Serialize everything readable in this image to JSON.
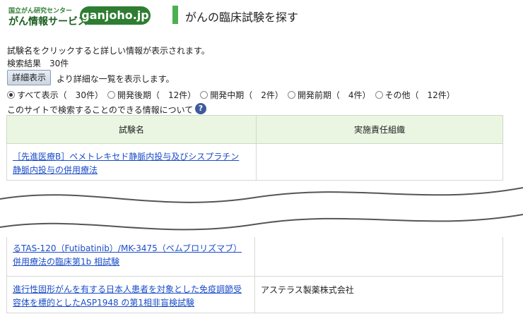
{
  "header": {
    "logo_small": "国立がん研究センター",
    "logo_big": "がん情報サービス",
    "logo_pill": "ganjoho.jp",
    "page_title": "がんの臨床試験を探す"
  },
  "intro": {
    "click_hint": "試験名をクリックすると詳しい情報が表示されます。",
    "results_count": "検索結果　30件",
    "detail_button": "詳細表示",
    "detail_hint": "より詳細な一覧を表示します。"
  },
  "filters": [
    {
      "label": "すべて表示（　30件）",
      "selected": true
    },
    {
      "label": "開発後期（　12件）",
      "selected": false
    },
    {
      "label": "開発中期（　2件）",
      "selected": false
    },
    {
      "label": "開発前期（　4件）",
      "selected": false
    },
    {
      "label": "その他（　12件）",
      "selected": false
    }
  ],
  "about_link": "このサイトで検索することのできる情報について",
  "help_icon": "?",
  "table": {
    "headers": [
      "試験名",
      "実施責任組織"
    ],
    "rows": [
      {
        "title_line1": "［先進医療B］ペメトレキセド静脈内投与及びシスプラチン",
        "title_line2": "静脈内投与の併用療法",
        "org": ""
      },
      {
        "title_line0": "",
        "title_line1": "るTAS-120（Futibatinib）/MK-3475（ペムブロリズマブ）",
        "title_line2": "併用療法の臨床第1b 相試験",
        "org": ""
      },
      {
        "title_line1": "進行性固形がんを有する日本人患者を対象とした免疫調節受",
        "title_line2": "容体を標的としたASP1948 の第1相非盲検試験",
        "org": "アステラス製薬株式会社"
      }
    ]
  },
  "colors": {
    "accent_green": "#4caf50",
    "link_blue": "#1a4cc8",
    "header_bg": "#eaf6e2"
  }
}
